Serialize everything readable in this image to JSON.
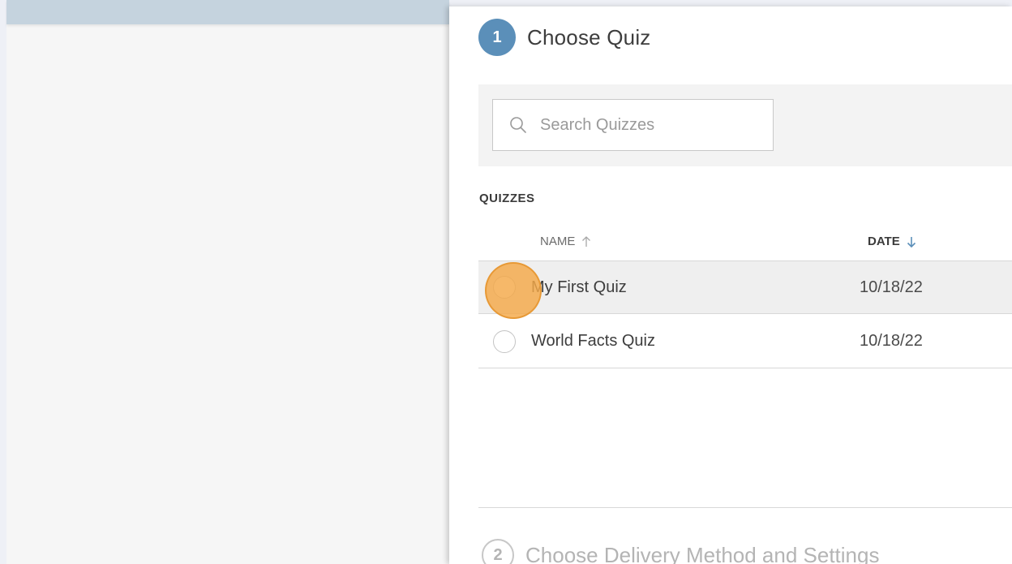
{
  "step1": {
    "number": "1",
    "title": "Choose Quiz"
  },
  "search": {
    "placeholder": "Search Quizzes",
    "value": "",
    "icon": "search-icon"
  },
  "quizzes": {
    "section_label": "QUIZZES",
    "columns": {
      "name": "NAME",
      "date": "DATE",
      "name_sort_icon": "arrow-up-icon",
      "date_sort_icon": "arrow-down-icon"
    },
    "rows": [
      {
        "name": "My First Quiz",
        "date": "10/18/22",
        "selected": true
      },
      {
        "name": "World Facts Quiz",
        "date": "10/18/22",
        "selected": false
      }
    ]
  },
  "step2": {
    "number": "2",
    "title": "Choose Delivery Method and Settings"
  },
  "colors": {
    "accent": "#5b8fb9",
    "click_indicator": "#f4a848",
    "disabled_text": "#b4b4b4"
  }
}
